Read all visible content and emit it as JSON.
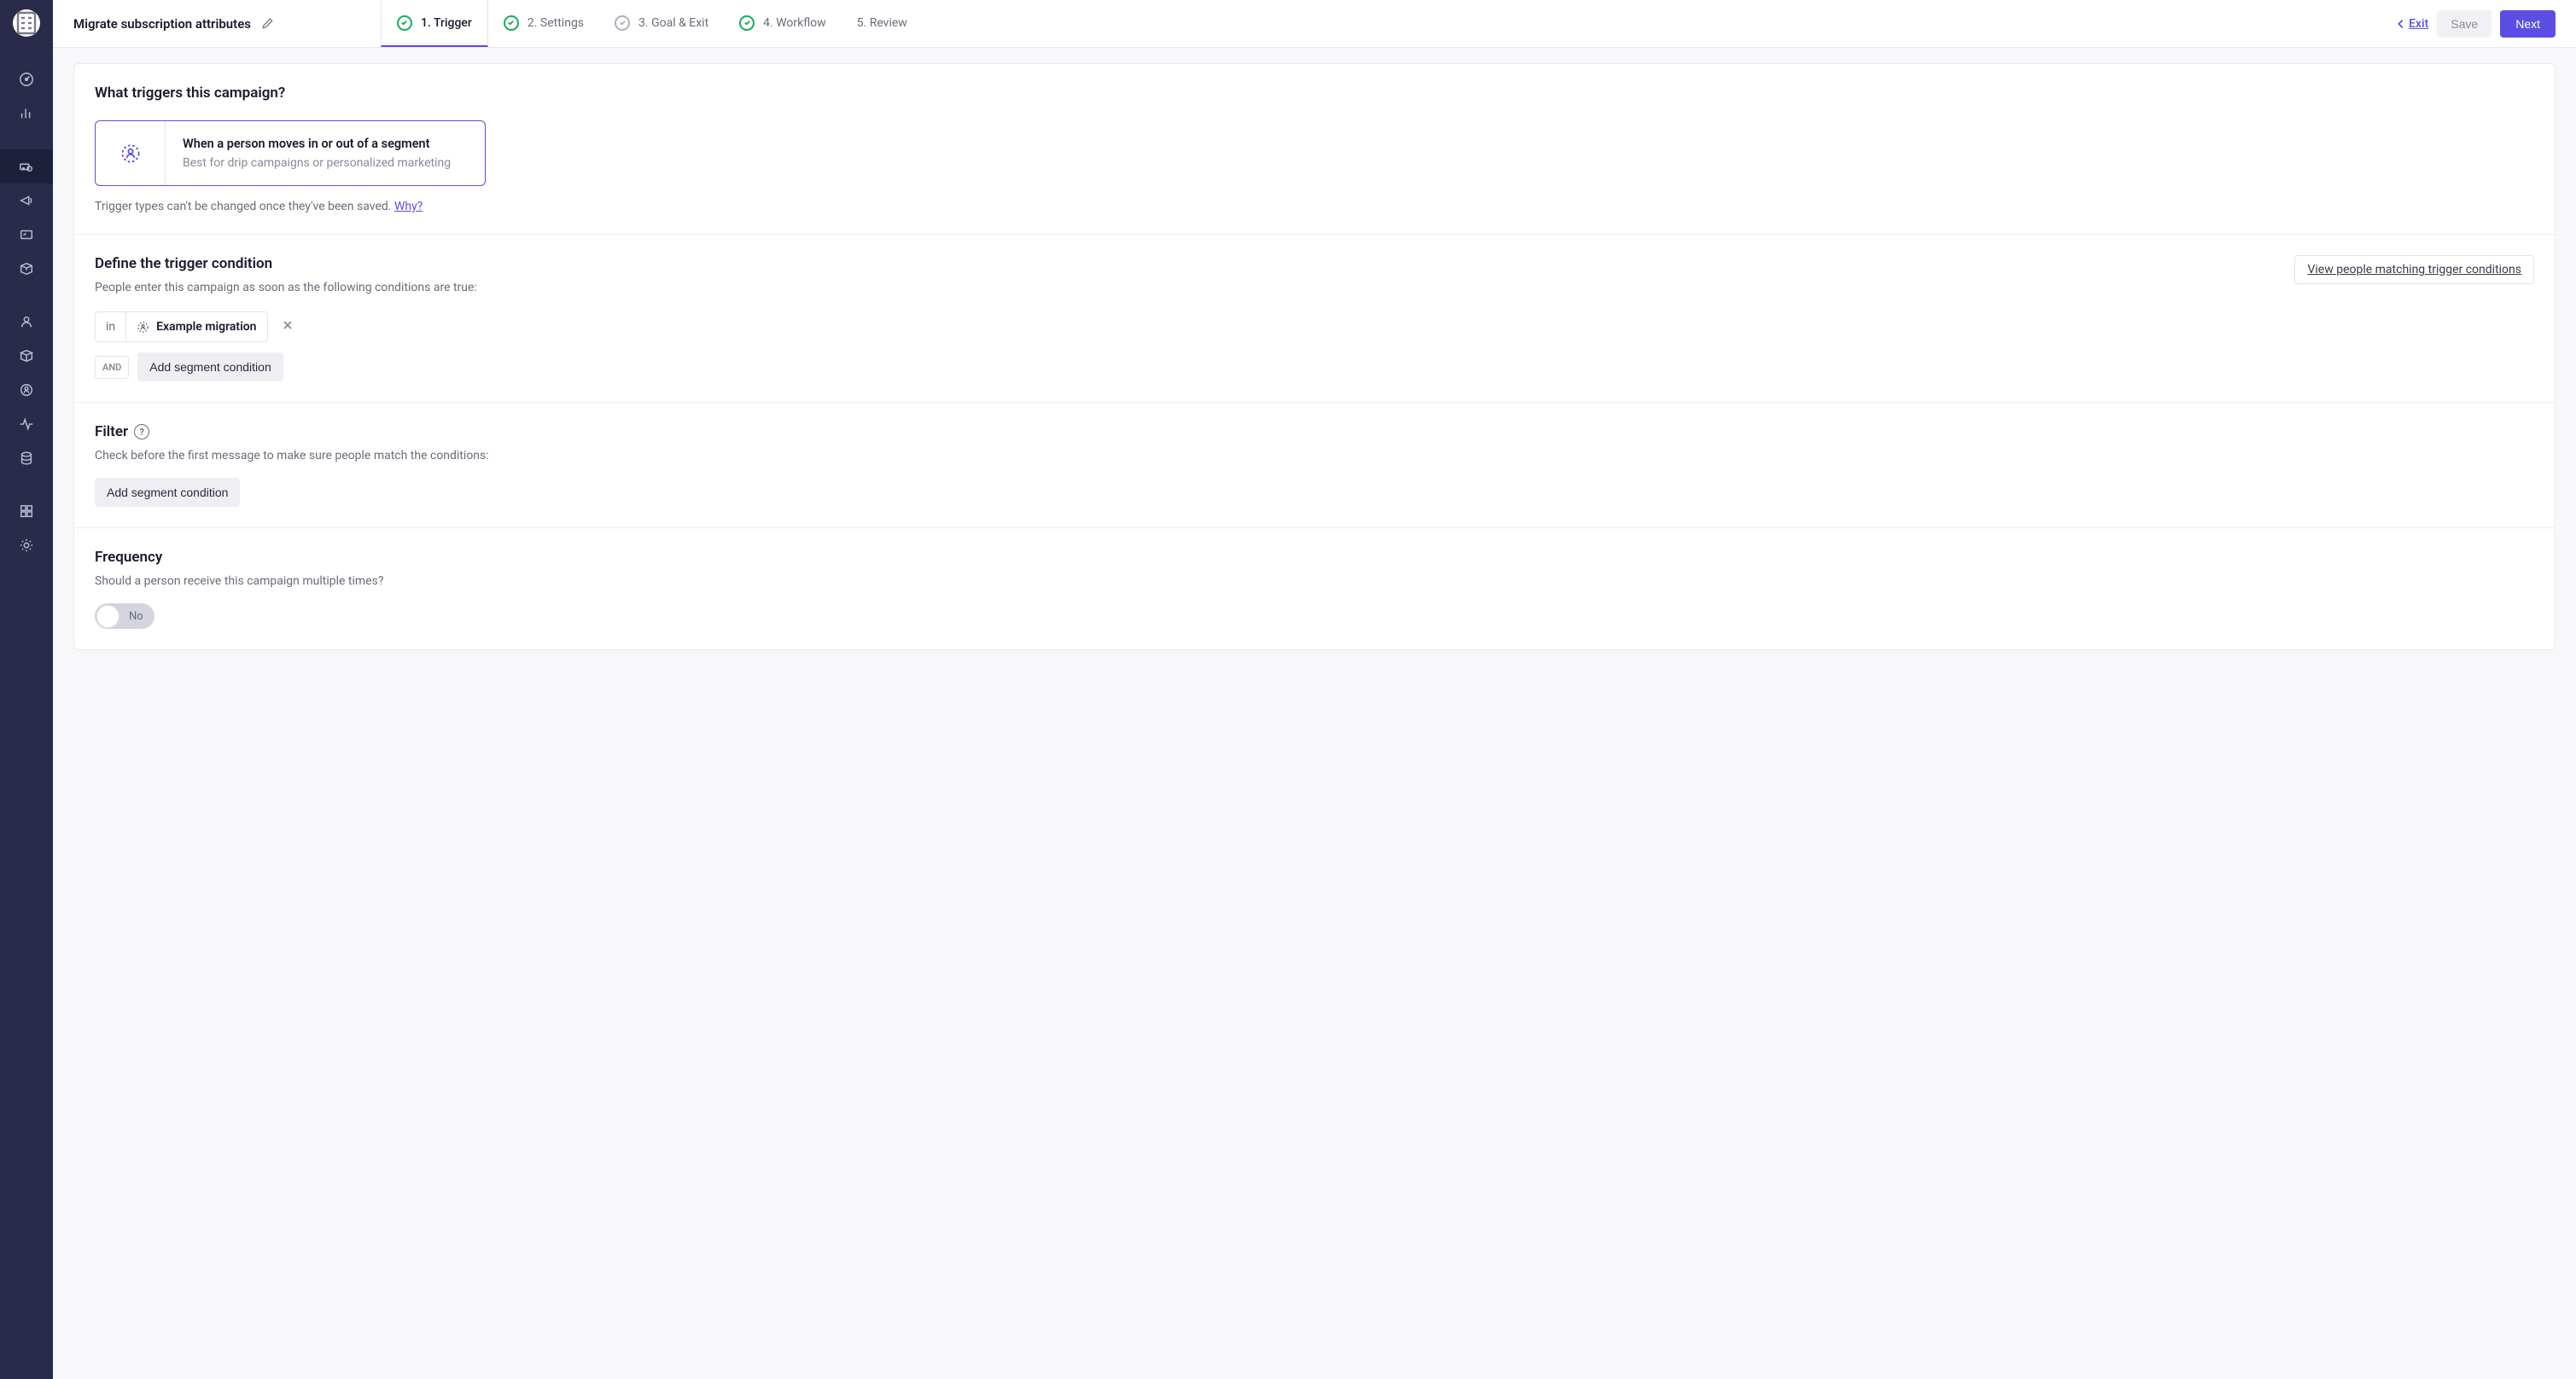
{
  "header": {
    "campaign_title": "Migrate subscription attributes",
    "exit_label": "Exit",
    "save_label": "Save",
    "next_label": "Next"
  },
  "steps": [
    {
      "label": "1. Trigger",
      "active": true,
      "check": "green"
    },
    {
      "label": "2. Settings",
      "active": false,
      "check": "green"
    },
    {
      "label": "3. Goal & Exit",
      "active": false,
      "check": "gray"
    },
    {
      "label": "4. Workflow",
      "active": false,
      "check": "green"
    },
    {
      "label": "5. Review",
      "active": false,
      "check": "none"
    }
  ],
  "trigger_section": {
    "title": "What triggers this campaign?",
    "card_title": "When a person moves in or out of a segment",
    "card_sub": "Best for drip campaigns or personalized marketing",
    "note_text": "Trigger types can't be changed once they've been saved. ",
    "why_link": "Why?"
  },
  "condition_section": {
    "title": "Define the trigger condition",
    "subtitle": "People enter this campaign as soon as the following conditions are true:",
    "view_link": "View people matching trigger conditions",
    "in_label": "in",
    "segment_name": "Example migration",
    "and_label": "AND",
    "add_button": "Add segment condition"
  },
  "filter_section": {
    "title": "Filter",
    "subtitle": "Check before the first message to make sure people match the conditions:",
    "add_button": "Add segment condition"
  },
  "frequency_section": {
    "title": "Frequency",
    "subtitle": "Should a person receive this campaign multiple times?",
    "toggle_label": "No",
    "toggle_on": false
  }
}
